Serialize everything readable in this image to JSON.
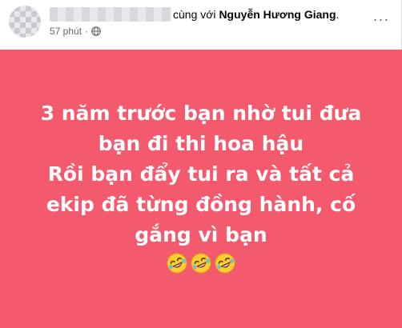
{
  "post": {
    "with_text": "cùng với",
    "tagged_name": "Nguyễn Hương Giang",
    "tagged_suffix": ".",
    "time": "57 phút",
    "dot": "·",
    "more": "···",
    "privacy_icon": "globe-icon",
    "status_lines": [
      "3 năm trước bạn nhờ tui đưa",
      "bạn đi thi hoa hậu",
      "Rồi bạn đẩy tui ra và tất cả",
      "ekip đã từng đồng hành, cố",
      "gắng vì bạn"
    ],
    "emoji_icon": "rolling-on-floor-laughing-icon",
    "background_color": "#f45a6d"
  }
}
